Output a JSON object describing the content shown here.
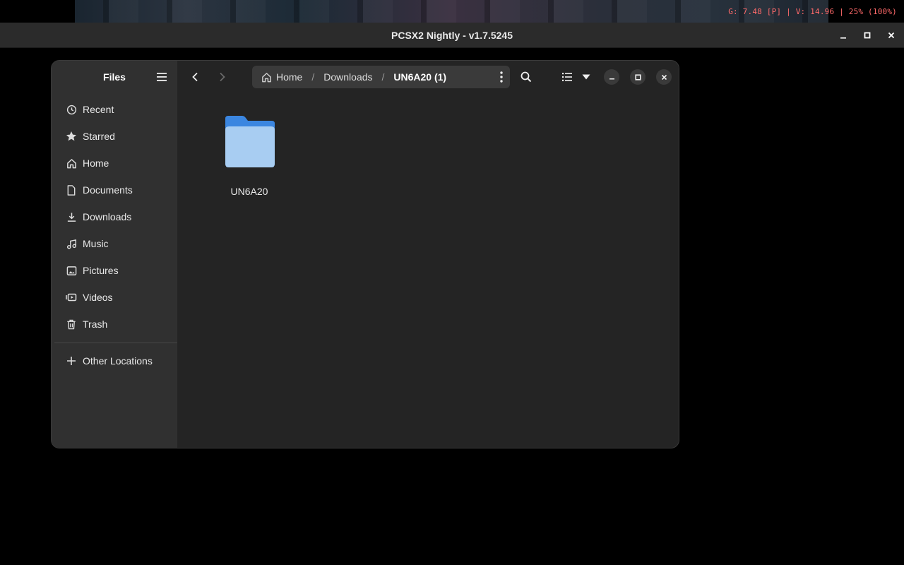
{
  "osd": {
    "text": "G: 7.48 [P] | V: 14.96 | 25% (100%)"
  },
  "pcsx2": {
    "title": "PCSX2 Nightly - v1.7.5245",
    "controls": {
      "minimize": "minimize-icon",
      "maximize": "maximize-icon",
      "close": "close-icon"
    }
  },
  "files": {
    "sidebar": {
      "title": "Files",
      "menu_icon": "hamburger-menu-icon",
      "places": [
        {
          "label": "Recent",
          "icon": "clock-icon"
        },
        {
          "label": "Starred",
          "icon": "star-icon"
        },
        {
          "label": "Home",
          "icon": "home-icon"
        },
        {
          "label": "Documents",
          "icon": "document-icon"
        },
        {
          "label": "Downloads",
          "icon": "download-icon"
        },
        {
          "label": "Music",
          "icon": "music-icon"
        },
        {
          "label": "Pictures",
          "icon": "picture-icon"
        },
        {
          "label": "Videos",
          "icon": "video-icon"
        },
        {
          "label": "Trash",
          "icon": "trash-icon"
        }
      ],
      "other": {
        "label": "Other Locations",
        "icon": "plus-icon"
      }
    },
    "toolbar": {
      "breadcrumb": [
        {
          "label": "Home",
          "icon": "home-icon"
        },
        {
          "label": "Downloads"
        },
        {
          "label": "UN6A20 (1)"
        }
      ]
    },
    "items": [
      {
        "name": "UN6A20",
        "type": "folder",
        "color": "#5e9fe8"
      }
    ]
  },
  "colors": {
    "osd": "#ff6a6a",
    "folder_front": "#a8cdf2",
    "folder_back": "#3b86e0",
    "sidebar_bg": "#303030",
    "content_bg": "#242424"
  }
}
